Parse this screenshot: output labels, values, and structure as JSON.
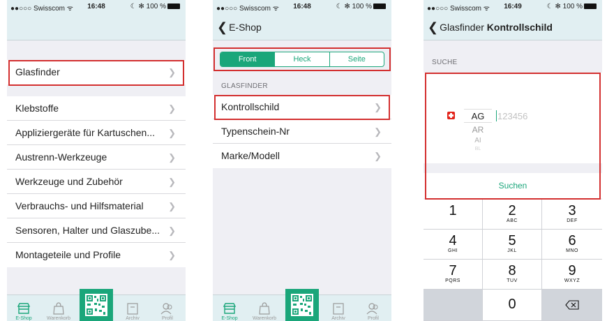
{
  "status_bar": {
    "phone1": {
      "carrier": "●●○○○ Swisscom ᯤ",
      "time": "16:48",
      "battery": "☾ ✻ 100 %"
    },
    "phone2": {
      "carrier": "●●○○○ Swisscom ᯤ",
      "time": "16:48",
      "battery": "☾ ✻ 100 %"
    },
    "phone3": {
      "carrier": "●●○○○ Swisscom ᯤ",
      "time": "16:49",
      "battery": "☾ ✻ 100 %"
    }
  },
  "phone1": {
    "items": [
      {
        "label": "Glasfinder"
      },
      {
        "label": "Klebstoffe"
      },
      {
        "label": "Appliziergeräte für Kartuschen..."
      },
      {
        "label": "Austrenn-Werkzeuge"
      },
      {
        "label": "Werkzeuge und Zubehör"
      },
      {
        "label": "Verbrauchs- und Hilfsmaterial"
      },
      {
        "label": "Sensoren, Halter und Glaszube..."
      },
      {
        "label": "Montageteile und Profile"
      }
    ]
  },
  "phone2": {
    "back_label": "E-Shop",
    "segments": [
      "Front",
      "Heck",
      "Seite"
    ],
    "active_segment": "Front",
    "section_label": "GLASFINDER",
    "items": [
      {
        "label": "Kontrollschild"
      },
      {
        "label": "Typenschein-Nr"
      },
      {
        "label": "Marke/Modell"
      }
    ]
  },
  "phone3": {
    "back_label": "Glasfinder",
    "title": "Kontrollschild",
    "section_label": "SUCHE",
    "canton_selected": "AG",
    "canton_next": [
      "AR",
      "AI",
      "BL"
    ],
    "plate_placeholder": "123456",
    "search_button": "Suchen",
    "keys": [
      {
        "num": "1",
        "letters": ""
      },
      {
        "num": "2",
        "letters": "ABC"
      },
      {
        "num": "3",
        "letters": "DEF"
      },
      {
        "num": "4",
        "letters": "GHI"
      },
      {
        "num": "5",
        "letters": "JKL"
      },
      {
        "num": "6",
        "letters": "MNO"
      },
      {
        "num": "7",
        "letters": "PQRS"
      },
      {
        "num": "8",
        "letters": "TUV"
      },
      {
        "num": "9",
        "letters": "WXYZ"
      },
      {
        "num": "0",
        "letters": ""
      },
      {
        "num": "⌫",
        "letters": ""
      }
    ]
  },
  "tabbar": {
    "tabs": [
      "E-Shop",
      "Warenkorb",
      "Archiv",
      "Profil"
    ],
    "active": "E-Shop"
  },
  "colors": {
    "accent": "#1aa67a",
    "highlight": "#d32f2f",
    "bar": "#e1eff2",
    "background": "#efeff4"
  },
  "icons": [
    "store-icon",
    "bag-icon",
    "qr-code-icon",
    "archive-icon",
    "profile-icon",
    "back-chevron-icon",
    "chevron-right-icon",
    "swiss-flag-icon",
    "backspace-icon"
  ]
}
